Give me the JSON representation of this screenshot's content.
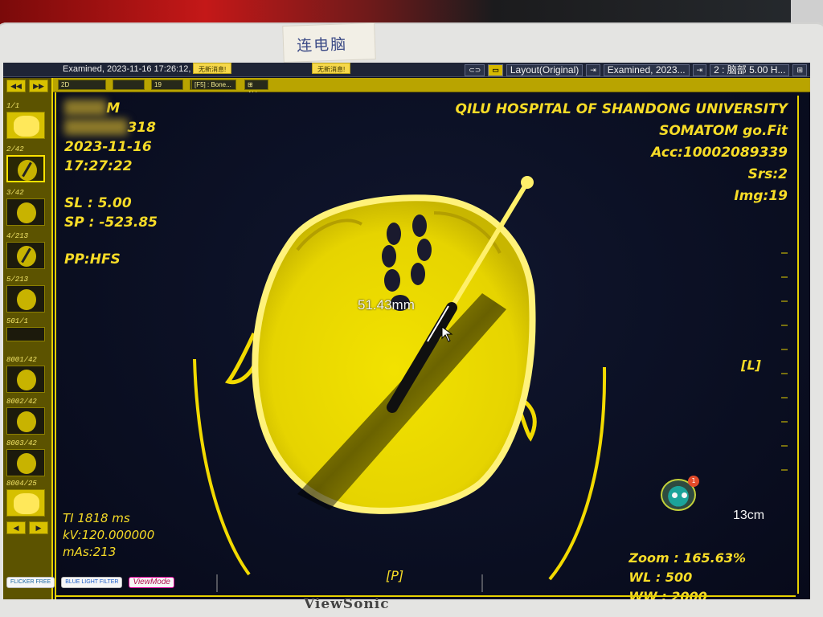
{
  "environment": {
    "tape_label": "连电脑",
    "brand": "ViewSonic",
    "bezel_logos": [
      "FLICKER FREE",
      "BLUE LIGHT FILTER",
      "ViewMode"
    ]
  },
  "topbar": {
    "left_text": "Examined, 2023-11-16 17:26:12,",
    "notices": [
      "无新消息!",
      "无新消息!"
    ],
    "layout_label": "Layout(Original)",
    "series_selector": "Examined, 2023...",
    "series_name": "2 : 脑部 5.00 H...",
    "small_buttons": [
      "⊂⊃",
      "▭"
    ]
  },
  "subbar": {
    "items": [
      "2D",
      "",
      "19",
      "",
      "[F5] : Bone...",
      "⊞ ALL"
    ]
  },
  "thumbnails": [
    {
      "label": "1/1",
      "style": "bright"
    },
    {
      "label": "2/42",
      "style": "active"
    },
    {
      "label": "3/42",
      "style": "normal"
    },
    {
      "label": "4/213",
      "style": "normal"
    },
    {
      "label": "5/213",
      "style": "normal"
    },
    {
      "label": "501/1",
      "style": "normal"
    },
    {
      "label": "8001/42",
      "style": "normal"
    },
    {
      "label": "8002/42",
      "style": "normal"
    },
    {
      "label": "8003/42",
      "style": "normal"
    },
    {
      "label": "8004/25",
      "style": "bright"
    }
  ],
  "nav": {
    "prev": "◀◀",
    "next": "▶▶",
    "first": "◀",
    "last": "▶"
  },
  "overlay": {
    "top_left": {
      "patient": "M",
      "id": "318",
      "date": "2023-11-16",
      "time": "17:27:22",
      "slice_thickness": "SL : 5.00",
      "slice_position": "SP : -523.85",
      "patient_position": "PP:HFS"
    },
    "top_right": {
      "institution": "QILU HOSPITAL OF SHANDONG UNIVERSITY",
      "device": "SOMATOM go.Fit",
      "accession": "Acc:10002089339",
      "series": "Srs:2",
      "image": "Img:19"
    },
    "bottom_left": {
      "ti": "TI 1818 ms",
      "kv": "kV:120.000000",
      "mas": "mAs:213"
    },
    "bottom_right": {
      "zoom": "Zoom : 165.63%",
      "wl": "WL : 500",
      "ww": "WW : 2000"
    },
    "orientation_left": "[L]",
    "orientation_bottom": "[P]",
    "scale": "13cm",
    "measurement": "51.43mm",
    "assistant_badge": "1"
  },
  "colors": {
    "overlay_text": "#f7dc27",
    "screen_bg": "#0b0f22",
    "frame": "#e7d200",
    "image_tint": "#ffe600"
  }
}
